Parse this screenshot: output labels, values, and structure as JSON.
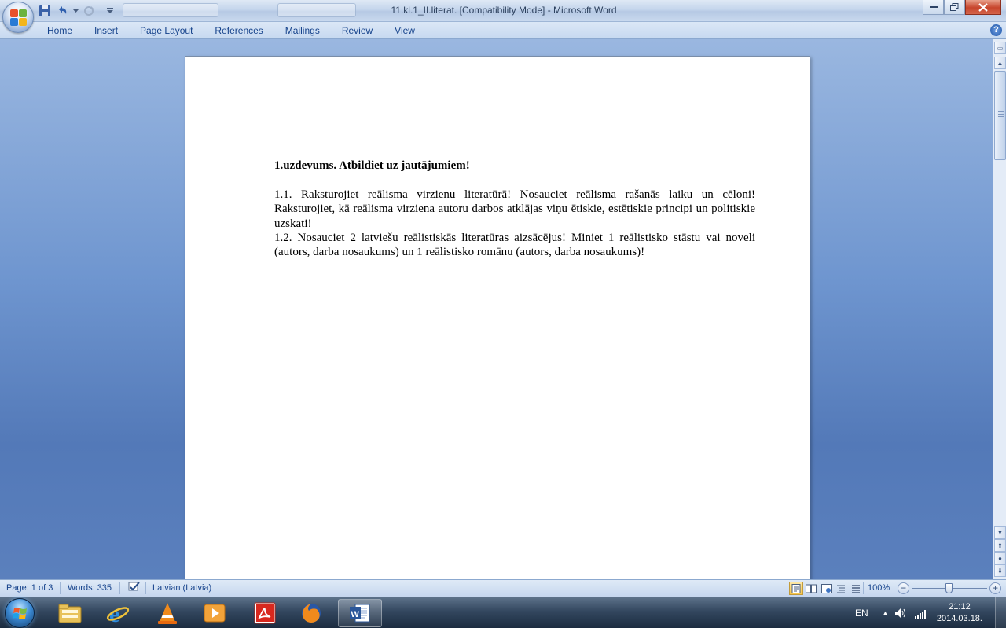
{
  "window": {
    "title": "11.kl.1_II.literat. [Compatibility Mode] - Microsoft Word"
  },
  "quick_access": {
    "icons": [
      "save-icon",
      "undo-icon",
      "redo-icon",
      "customize-qat-icon"
    ]
  },
  "ribbon": {
    "tabs": [
      {
        "label": "Home"
      },
      {
        "label": "Insert"
      },
      {
        "label": "Page Layout"
      },
      {
        "label": "References"
      },
      {
        "label": "Mailings"
      },
      {
        "label": "Review"
      },
      {
        "label": "View"
      }
    ],
    "help_label": "?"
  },
  "document": {
    "heading": "1.uzdevums. Atbildiet uz jautājumiem!",
    "paragraph_1": "1.1. Raksturojiet reālisma virzienu literatūrā! Nosauciet reālisma rašanās laiku un cēloni! Raksturojiet, kā reālisma virziena autoru darbos atklājas viņu ētiskie, estētiskie principi un politiskie uzskati!",
    "paragraph_2": "1.2. Nosauciet 2 latviešu reālistiskās literatūras aizsācējus! Miniet 1 reālistisko stāstu vai noveli (autors, darba nosaukums) un 1 reālistisko romānu (autors, darba nosaukums)!"
  },
  "status_bar": {
    "page": "Page: 1 of 3",
    "words": "Words: 335",
    "language": "Latvian (Latvia)",
    "zoom": "100%",
    "zoom_minus": "−",
    "zoom_plus": "+"
  },
  "taskbar": {
    "apps": [
      "windows-explorer-icon",
      "internet-explorer-icon",
      "vlc-icon",
      "media-player-icon",
      "acrobat-icon",
      "firefox-icon",
      "word-icon"
    ],
    "language": "EN",
    "time": "21:12",
    "date": "2014.03.18."
  },
  "colors": {
    "ribbon_text": "#15428b",
    "workspace": "#6e95cf",
    "close_button": "#c7452c"
  }
}
